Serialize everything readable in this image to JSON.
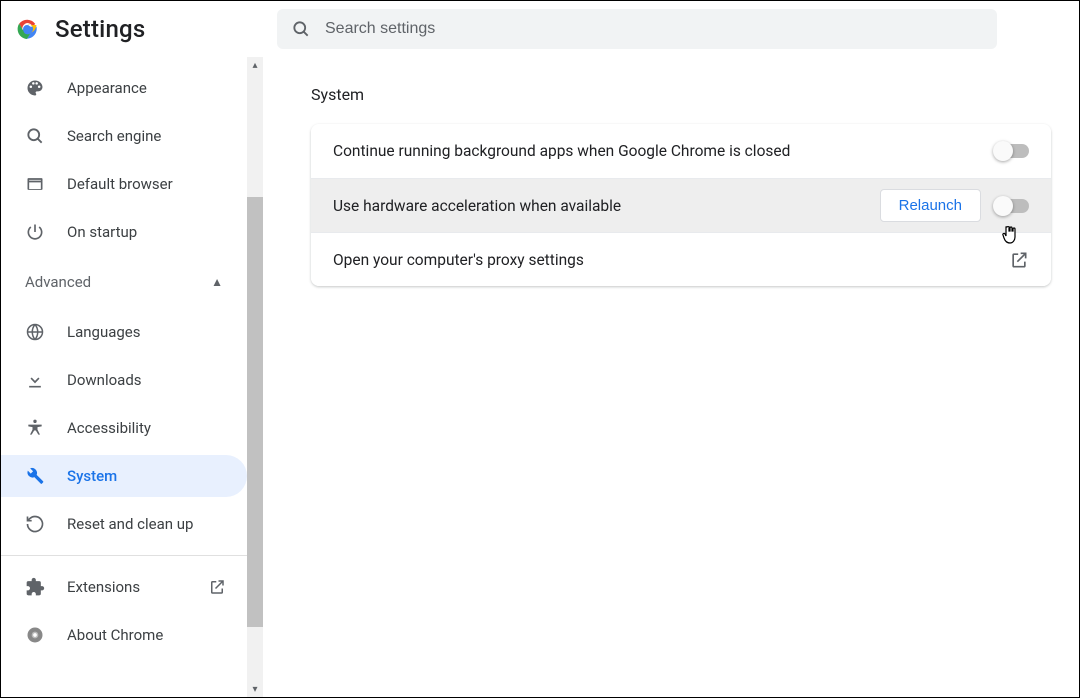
{
  "header": {
    "title": "Settings",
    "search_placeholder": "Search settings"
  },
  "sidebar": {
    "items_top": [
      {
        "id": "appearance",
        "label": "Appearance",
        "icon": "palette"
      },
      {
        "id": "search-engine",
        "label": "Search engine",
        "icon": "search"
      },
      {
        "id": "default-browser",
        "label": "Default browser",
        "icon": "browser"
      },
      {
        "id": "on-startup",
        "label": "On startup",
        "icon": "power"
      }
    ],
    "advanced_label": "Advanced",
    "items_advanced": [
      {
        "id": "languages",
        "label": "Languages",
        "icon": "globe"
      },
      {
        "id": "downloads",
        "label": "Downloads",
        "icon": "download"
      },
      {
        "id": "accessibility",
        "label": "Accessibility",
        "icon": "accessibility"
      },
      {
        "id": "system",
        "label": "System",
        "icon": "wrench",
        "active": true
      },
      {
        "id": "reset",
        "label": "Reset and clean up",
        "icon": "restore"
      }
    ],
    "items_bottom": [
      {
        "id": "extensions",
        "label": "Extensions",
        "icon": "puzzle",
        "external": true
      },
      {
        "id": "about",
        "label": "About Chrome",
        "icon": "chrome-gray"
      }
    ]
  },
  "main": {
    "section_title": "System",
    "rows": [
      {
        "id": "bg-apps",
        "label": "Continue running background apps when Google Chrome is closed",
        "type": "toggle",
        "value": false
      },
      {
        "id": "hw-accel",
        "label": "Use hardware acceleration when available",
        "type": "toggle",
        "value": false,
        "relaunch": true,
        "relaunch_label": "Relaunch",
        "hover": true
      },
      {
        "id": "proxy",
        "label": "Open your computer's proxy settings",
        "type": "link"
      }
    ]
  }
}
